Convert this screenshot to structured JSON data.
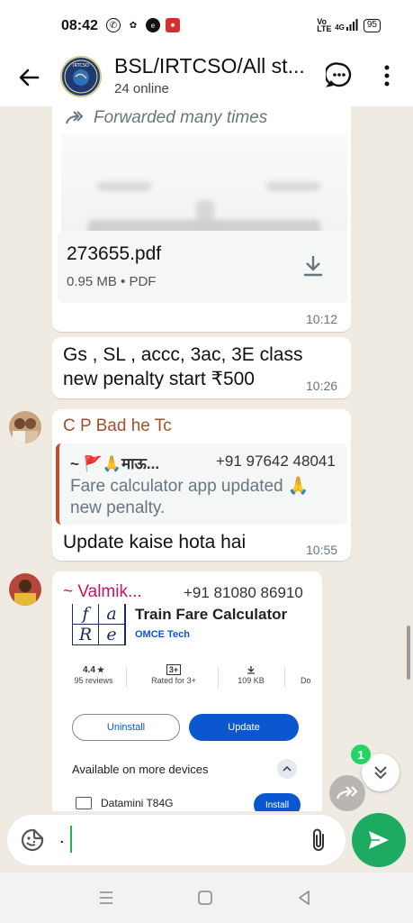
{
  "status_bar": {
    "time": "08:42",
    "network": "4G",
    "battery": "95",
    "volte": "Vo LTE"
  },
  "header": {
    "title": "BSL/IRTCSO/All st...",
    "subtitle": "24 online",
    "avatar_text": "IRTCSO"
  },
  "messages": [
    {
      "forwarded_label": "Forwarded many times",
      "file_name": "273655.pdf",
      "file_meta": "0.95 MB • PDF",
      "time": "10:12"
    },
    {
      "text": "Gs , SL , accc, 3ac, 3E class new penalty start ₹500",
      "time": "10:26"
    },
    {
      "sender": "C P Bad he Tc",
      "quote_author": "~ 🚩🙏माऊ...",
      "quote_phone": "+91 97642 48041",
      "quote_text": "Fare calculator  app updated 🙏 new penalty.",
      "text": "Update kaise hota hai",
      "time": "10:55"
    },
    {
      "sender": "~ Valmik...",
      "sender_phone": "+91 81080 86910",
      "app": {
        "icon_letters": [
          "f",
          "a",
          "R",
          "e"
        ],
        "name": "Train Fare Calculator",
        "developer": "OMCE Tech",
        "rating": "4.4",
        "reviews": "95 reviews",
        "age_rating": "3+",
        "age_label": "Rated for 3+",
        "size": "109 KB",
        "size_label": "109 KB",
        "downloads_label": "Do",
        "uninstall_label": "Uninstall",
        "update_label": "Update",
        "more_devices": "Available on more devices",
        "device_name": "Datamini T84G",
        "install_label": "Install"
      }
    }
  ],
  "unread_count": "1",
  "composer": {
    "text": "."
  },
  "colors": {
    "send_green": "#1daa61",
    "chat_bg": "#efeae2",
    "sender_cp": "#a0522d",
    "sender_valmik": "#c2185b",
    "link_blue": "#0b57d0"
  }
}
